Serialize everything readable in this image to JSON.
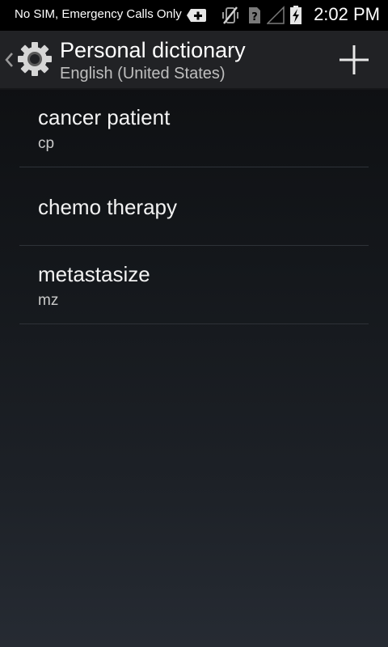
{
  "status_bar": {
    "carrier": "No SIM, Emergency Calls Only",
    "time": "2:02 PM",
    "icons": [
      "notification-add-icon",
      "vibrate-off-icon",
      "no-sim-icon",
      "signal-icon",
      "battery-charging-icon"
    ]
  },
  "action_bar": {
    "title": "Personal dictionary",
    "subtitle": "English (United States)",
    "icon": "settings-gear-icon",
    "add_icon": "plus-icon"
  },
  "entries": [
    {
      "word": "cancer patient",
      "shortcut": "cp"
    },
    {
      "word": "chemo therapy",
      "shortcut": ""
    },
    {
      "word": "metastasize",
      "shortcut": "mz"
    }
  ]
}
